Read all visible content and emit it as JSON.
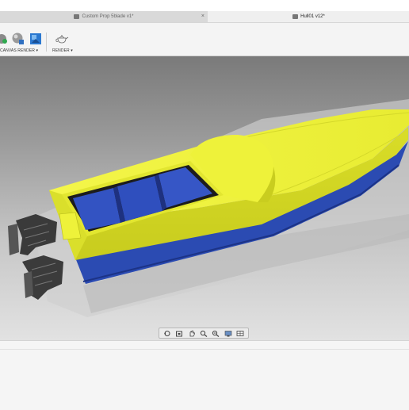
{
  "tabs": [
    {
      "label": "Custom Prop 5blade v1*",
      "icon": "document-icon",
      "active": false
    },
    {
      "label": "Hull01 v12*",
      "icon": "document-icon",
      "active": true
    }
  ],
  "toolbar": {
    "canvas_render_label": "CANVAS RENDER",
    "render_label": "RENDER",
    "dropdown_glyph": "▾"
  },
  "tab_close_glyph": "×",
  "navbar": {
    "tools": [
      "orbit",
      "look-at",
      "pan",
      "zoom-window",
      "zoom",
      "display-settings",
      "grid-settings"
    ]
  },
  "colors": {
    "hull_yellow": "#eef23a",
    "hull_blue": "#2b4bb2",
    "viewport_top": "#7a7a7a",
    "viewport_bottom": "#e2e2e2"
  }
}
